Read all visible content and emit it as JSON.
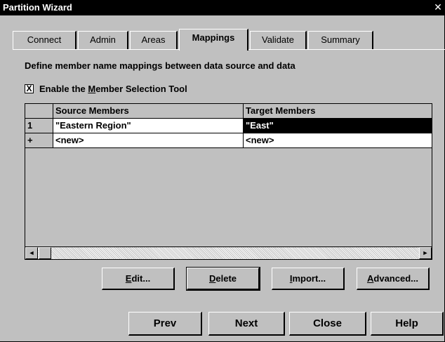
{
  "window": {
    "title": "Partition Wizard",
    "close_glyph": "✕"
  },
  "tabs": [
    {
      "label": "Connect"
    },
    {
      "label": "Admin"
    },
    {
      "label": "Areas"
    },
    {
      "label": "Mappings",
      "active": true
    },
    {
      "label": "Validate"
    },
    {
      "label": "Summary"
    }
  ],
  "description": "Define member name mappings between data source and data",
  "member_tool": {
    "checked": true,
    "check_glyph": "X",
    "label_pre": "Enable the ",
    "label_accel": "M",
    "label_post": "ember Selection Tool"
  },
  "grid": {
    "headers": [
      "",
      "Source Members",
      "Target Members"
    ],
    "rows": [
      {
        "index": "1",
        "source": "\"Eastern Region\"",
        "target": "\"East\""
      },
      {
        "index": "+",
        "source": "<new>",
        "target": "<new>"
      }
    ]
  },
  "scrollbar": {
    "left_arrow": "◄",
    "right_arrow": "►"
  },
  "grid_buttons": {
    "edit": {
      "accel": "E",
      "rest": "dit..."
    },
    "delete": {
      "accel": "D",
      "rest": "elete"
    },
    "import": {
      "accel": "I",
      "rest": "mport..."
    },
    "advanced": {
      "accel": "A",
      "rest": "dvanced..."
    }
  },
  "nav_buttons": {
    "prev": "Prev",
    "next": "Next",
    "close": "Close",
    "help": "Help"
  }
}
